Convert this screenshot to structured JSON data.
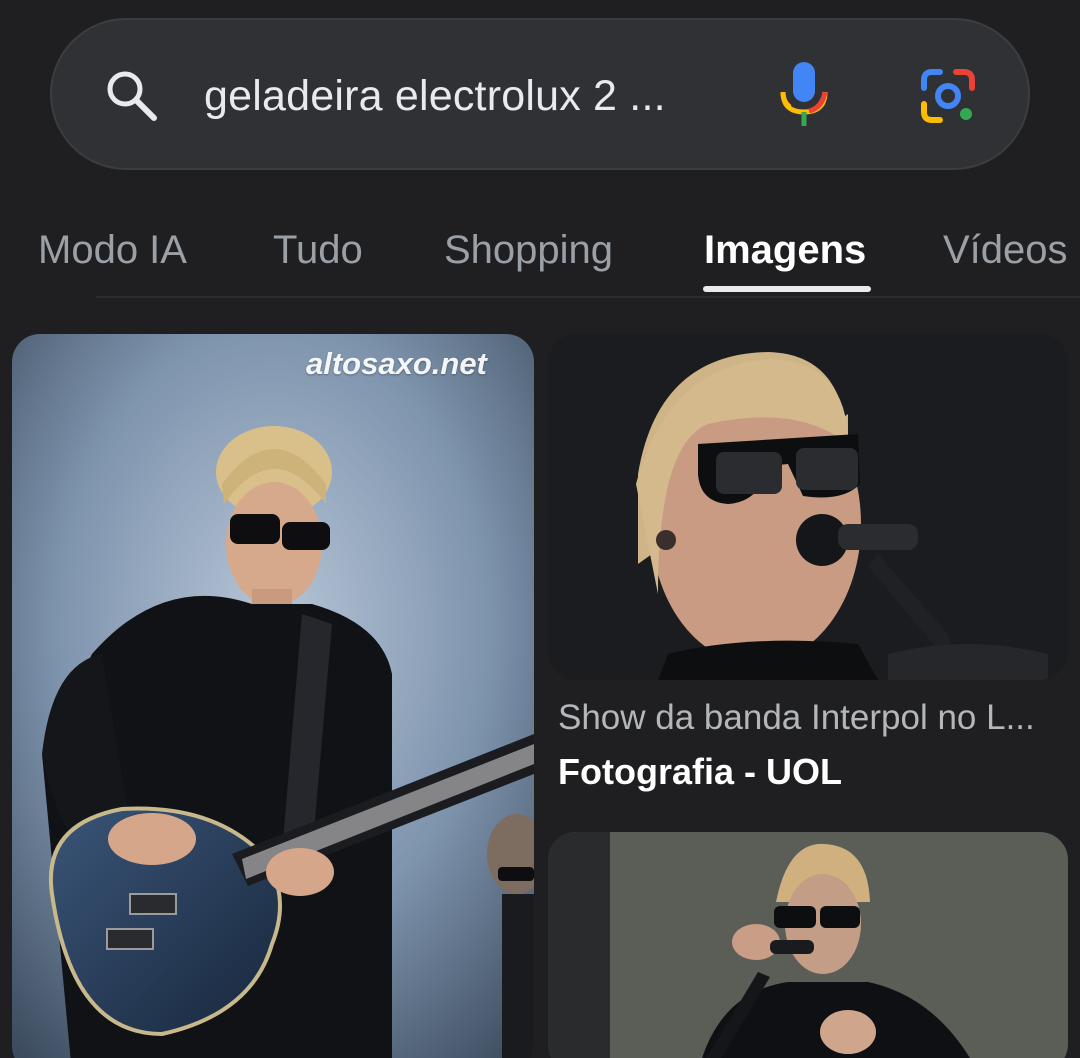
{
  "search": {
    "query": "geladeira electrolux 2 ..."
  },
  "tabs": [
    {
      "label": "Modo IA"
    },
    {
      "label": "Tudo"
    },
    {
      "label": "Shopping"
    },
    {
      "label": "Imagens",
      "active": true
    },
    {
      "label": "Vídeos"
    }
  ],
  "results": [
    {
      "watermark": "altosaxo.net",
      "image": "guitarist-blue-guitar-photo"
    },
    {
      "title": "Show da banda Interpol no L...",
      "source": "Fotografia - UOL",
      "image": "singer-microphone-closeup-photo"
    },
    {
      "image": "singer-on-stage-photo"
    }
  ],
  "colors": {
    "background": "#1f1f21",
    "search_bar": "#303134",
    "tab_inactive": "#9aa0a6",
    "tab_active": "#ffffff"
  }
}
